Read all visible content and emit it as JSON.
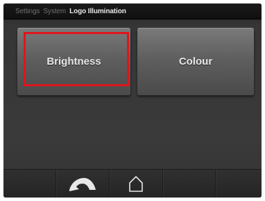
{
  "header": {
    "breadcrumbs": [
      {
        "label": "Settings"
      },
      {
        "label": "System"
      },
      {
        "label": "Logo Illumination"
      }
    ]
  },
  "tiles": [
    {
      "label": "Brightness",
      "selected": true
    },
    {
      "label": "Colour",
      "selected": false
    }
  ],
  "footer": {
    "buttons": [
      {
        "icon": "back-arrow-icon"
      },
      {
        "icon": "home-icon"
      }
    ]
  },
  "colors": {
    "selection_frame": "#e0151b",
    "tile_text": "#e6e6e6",
    "breadcrumb_inactive": "#6f6f6f",
    "breadcrumb_active": "#e8e8e8"
  }
}
